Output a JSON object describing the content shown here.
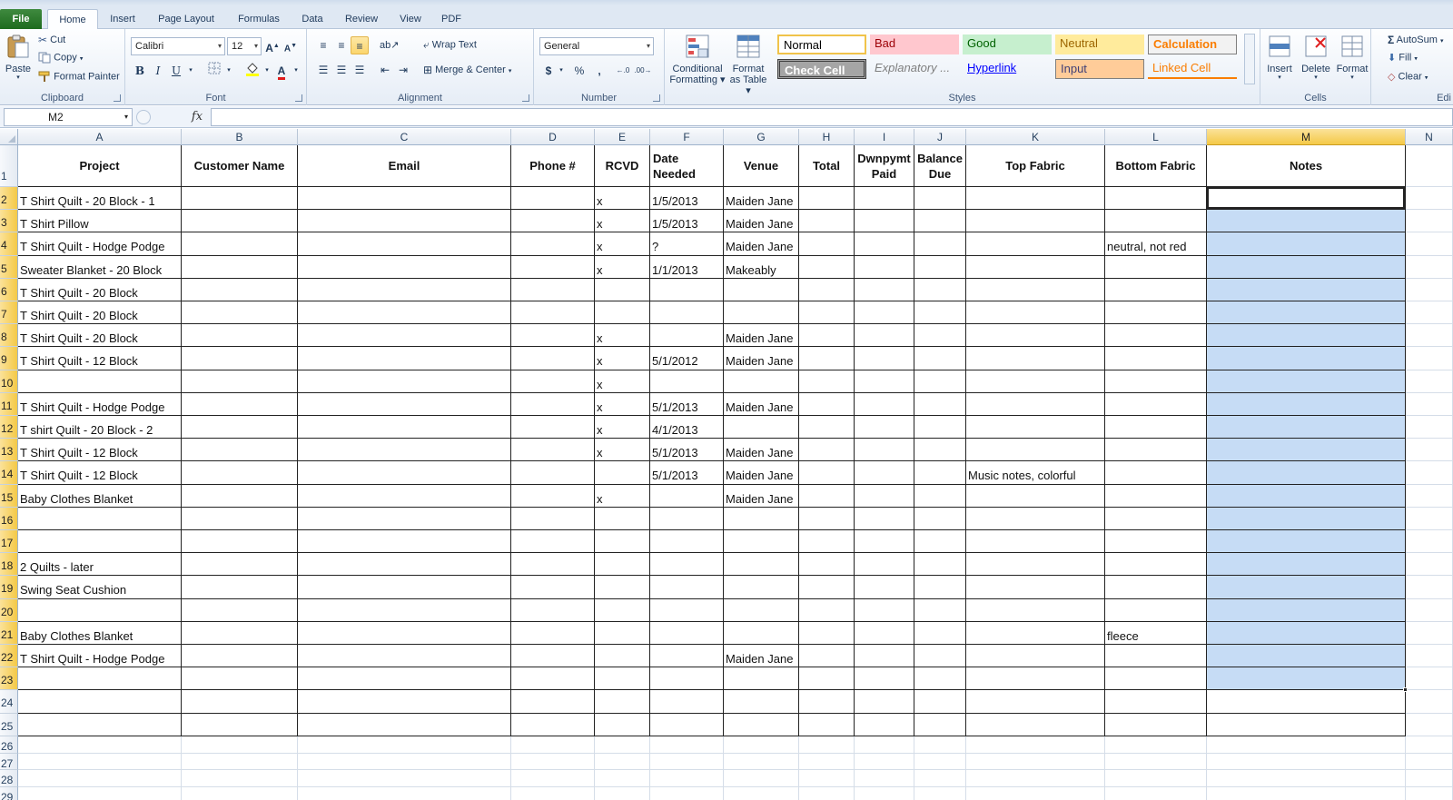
{
  "tabs": [
    "File",
    "Home",
    "Insert",
    "Page Layout",
    "Formulas",
    "Data",
    "Review",
    "View",
    "PDF"
  ],
  "ribbon": {
    "clipboard": {
      "label": "Clipboard",
      "paste": "Paste",
      "cut": "Cut",
      "copy": "Copy",
      "format_painter": "Format Painter"
    },
    "font": {
      "label": "Font",
      "name": "Calibri",
      "size": "12"
    },
    "alignment": {
      "label": "Alignment",
      "wrap": "Wrap Text",
      "merge": "Merge & Center"
    },
    "number": {
      "label": "Number",
      "format": "General"
    },
    "styles": {
      "label": "Styles",
      "conditional": "Conditional Formatting",
      "format_table": "Format as Table",
      "gallery": [
        "Normal",
        "Bad",
        "Good",
        "Neutral",
        "Calculation",
        "Check Cell",
        "Explanatory ...",
        "Hyperlink",
        "Input",
        "Linked Cell"
      ]
    },
    "cells": {
      "label": "Cells",
      "insert": "Insert",
      "delete": "Delete",
      "format": "Format"
    },
    "editing": {
      "label": "Edi",
      "autosum": "AutoSum",
      "fill": "Fill",
      "clear": "Clear"
    }
  },
  "formula_bar": {
    "name_box": "M2",
    "fx": "fx",
    "value": ""
  },
  "columns": [
    "A",
    "B",
    "C",
    "D",
    "E",
    "F",
    "G",
    "H",
    "I",
    "J",
    "K",
    "L",
    "M",
    "N"
  ],
  "selected_column": "M",
  "header_row": [
    "Project",
    "Customer Name",
    "Email",
    "Phone #",
    "RCVD",
    "Date Needed",
    "Venue",
    "Total",
    "Dwnpymt Paid",
    "Balance Due",
    "Top Fabric",
    "Bottom Fabric",
    "Notes"
  ],
  "rows": [
    [
      "T Shirt Quilt - 20 Block - 1",
      "",
      "",
      "",
      "x",
      "1/5/2013",
      "Maiden Jane",
      "",
      "",
      "",
      "",
      "",
      ""
    ],
    [
      "T Shirt Pillow",
      "",
      "",
      "",
      "x",
      "1/5/2013",
      "Maiden Jane",
      "",
      "",
      "",
      "",
      "",
      ""
    ],
    [
      "T Shirt Quilt - Hodge Podge",
      "",
      "",
      "",
      "x",
      "?",
      "Maiden Jane",
      "",
      "",
      "",
      "",
      "neutral, not red",
      ""
    ],
    [
      "Sweater Blanket - 20 Block",
      "",
      "",
      "",
      "x",
      "1/1/2013",
      "Makeably",
      "",
      "",
      "",
      "",
      "",
      ""
    ],
    [
      "T Shirt Quilt - 20 Block",
      "",
      "",
      "",
      "",
      "",
      "",
      "",
      "",
      "",
      "",
      "",
      ""
    ],
    [
      "T Shirt Quilt - 20 Block",
      "",
      "",
      "",
      "",
      "",
      "",
      "",
      "",
      "",
      "",
      "",
      ""
    ],
    [
      "T Shirt Quilt - 20 Block",
      "",
      "",
      "",
      "x",
      "",
      "Maiden Jane",
      "",
      "",
      "",
      "",
      "",
      ""
    ],
    [
      "T Shirt Quilt - 12 Block",
      "",
      "",
      "",
      "x",
      "5/1/2012",
      "Maiden Jane",
      "",
      "",
      "",
      "",
      "",
      ""
    ],
    [
      "",
      "",
      "",
      "",
      "x",
      "",
      "",
      "",
      "",
      "",
      "",
      "",
      ""
    ],
    [
      "T Shirt Quilt - Hodge Podge",
      "",
      "",
      "",
      "x",
      "5/1/2013",
      "Maiden Jane",
      "",
      "",
      "",
      "",
      "",
      ""
    ],
    [
      "T shirt Quilt - 20 Block - 2",
      "",
      "",
      "",
      "x",
      "4/1/2013",
      "",
      "",
      "",
      "",
      "",
      "",
      ""
    ],
    [
      "T Shirt Quilt - 12 Block",
      "",
      "",
      "",
      "x",
      "5/1/2013",
      "Maiden Jane",
      "",
      "",
      "",
      "",
      "",
      ""
    ],
    [
      "T Shirt Quilt - 12 Block",
      "",
      "",
      "",
      "",
      "5/1/2013",
      "Maiden Jane",
      "",
      "",
      "",
      "Music notes, colorful",
      "",
      ""
    ],
    [
      "Baby Clothes Blanket",
      "",
      "",
      "",
      "x",
      "",
      "Maiden Jane",
      "",
      "",
      "",
      "",
      "",
      ""
    ],
    [
      "",
      "",
      "",
      "",
      "",
      "",
      "",
      "",
      "",
      "",
      "",
      "",
      ""
    ],
    [
      "",
      "",
      "",
      "",
      "",
      "",
      "",
      "",
      "",
      "",
      "",
      "",
      ""
    ],
    [
      "2 Quilts - later",
      "",
      "",
      "",
      "",
      "",
      "",
      "",
      "",
      "",
      "",
      "",
      ""
    ],
    [
      "Swing Seat Cushion",
      "",
      "",
      "",
      "",
      "",
      "",
      "",
      "",
      "",
      "",
      "",
      ""
    ],
    [
      "",
      "",
      "",
      "",
      "",
      "",
      "",
      "",
      "",
      "",
      "",
      "",
      ""
    ],
    [
      "Baby Clothes Blanket",
      "",
      "",
      "",
      "",
      "",
      "",
      "",
      "",
      "",
      "",
      "fleece",
      ""
    ],
    [
      "T Shirt Quilt - Hodge Podge",
      "",
      "",
      "",
      "",
      "",
      "Maiden Jane",
      "",
      "",
      "",
      "",
      "",
      ""
    ],
    [
      "",
      "",
      "",
      "",
      "",
      "",
      "",
      "",
      "",
      "",
      "",
      "",
      ""
    ],
    [
      "",
      "",
      "",
      "",
      "",
      "",
      "",
      "",
      "",
      "",
      "",
      "",
      ""
    ],
    [
      "",
      "",
      "",
      "",
      "",
      "",
      "",
      "",
      "",
      "",
      "",
      "",
      ""
    ]
  ],
  "row_numbers": [
    "1",
    "2",
    "3",
    "4",
    "5",
    "6",
    "7",
    "8",
    "9",
    "10",
    "11",
    "12",
    "13",
    "14",
    "15",
    "16",
    "17",
    "18",
    "19",
    "20",
    "21",
    "22",
    "23",
    "24",
    "25",
    "26",
    "27",
    "28",
    "29"
  ],
  "colors": {
    "selection_fill": "#c6dcf5",
    "selected_header": "#f4c947",
    "accent": "#1e6b1e"
  }
}
